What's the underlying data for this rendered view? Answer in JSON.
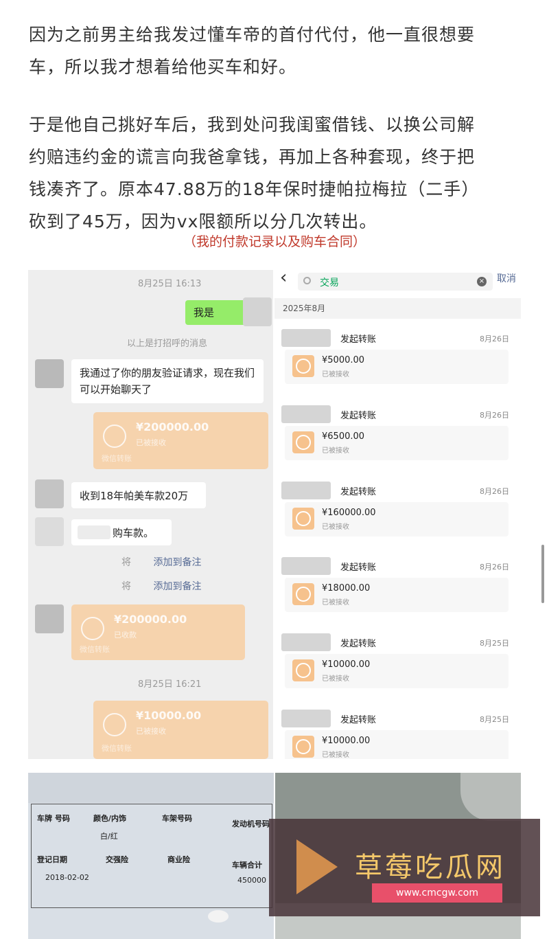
{
  "article": {
    "p1_line1": "因为之前男主给我发过懂车帝的首付代付，他一直很想要",
    "p1_line2": "车，所以我才想着给他买车和好。",
    "p2_line1": "于是他自己挑好车后，我到处问我闺蜜借钱、以换公司解",
    "p2_line2": "约赔违约金的谎言向我爸拿钱，再加上各种套现，终于把",
    "p2_line3": "钱凑齐了。原本47.88万的18年保时捷帕拉梅拉（二手）",
    "p2_line4": "砍到了45万，因为vx限额所以分几次转出。",
    "caption": "（我的付款记录以及购车合同）"
  },
  "chat": {
    "time1": "8月25日 16:13",
    "me_msg": "我是",
    "hint": "以上是打招呼的消息",
    "msg_verify": "我通过了你的朋友验证请求，现在我们可以开始聊天了",
    "pay1_amount": "¥200000.00",
    "pay1_status": "已被接收",
    "pay1_footer": "微信转账",
    "msg_received": "收到18年帕美车款20万",
    "msg_carpay": "购车款。",
    "note1_prefix": "将",
    "note1_link": "添加到备注",
    "note2_prefix": "将",
    "note2_link": "添加到备注",
    "pay2_amount": "¥200000.00",
    "pay2_status": "已收款",
    "pay2_footer": "微信转账",
    "time2": "8月25日 16:21",
    "pay3_amount": "¥10000.00",
    "pay3_status": "已被接收",
    "pay3_footer": "微信转账"
  },
  "search": {
    "back": "‹",
    "query": "交易",
    "cancel": "取消",
    "month": "2025年8月",
    "rows": [
      {
        "title": "发起转账",
        "date": "8月26日",
        "amount": "¥5000.00",
        "status": "已被接收"
      },
      {
        "title": "发起转账",
        "date": "8月26日",
        "amount": "¥6500.00",
        "status": "已被接收"
      },
      {
        "title": "发起转账",
        "date": "8月26日",
        "amount": "¥160000.00",
        "status": "已被接收"
      },
      {
        "title": "发起转账",
        "date": "8月26日",
        "amount": "¥18000.00",
        "status": "已被接收"
      },
      {
        "title": "发起转账",
        "date": "8月25日",
        "amount": "¥10000.00",
        "status": "已被接收"
      },
      {
        "title": "发起转账",
        "date": "8月25日",
        "amount": "¥10000.00",
        "status": "已被接收"
      }
    ]
  },
  "contract": {
    "h1": "车牌 号码",
    "h2": "颜色/内饰",
    "h3": "车架号码",
    "h4": "发动机号码",
    "h5": "登记日期",
    "h6": "交强险",
    "h7": "商业险",
    "h8": "车辆合计",
    "v_date": "2018-02-02",
    "v_total": "450000",
    "v_color": "白/红"
  },
  "watermark": {
    "brand": "草莓吃瓜网",
    "url": "www.cmcgw.com"
  }
}
